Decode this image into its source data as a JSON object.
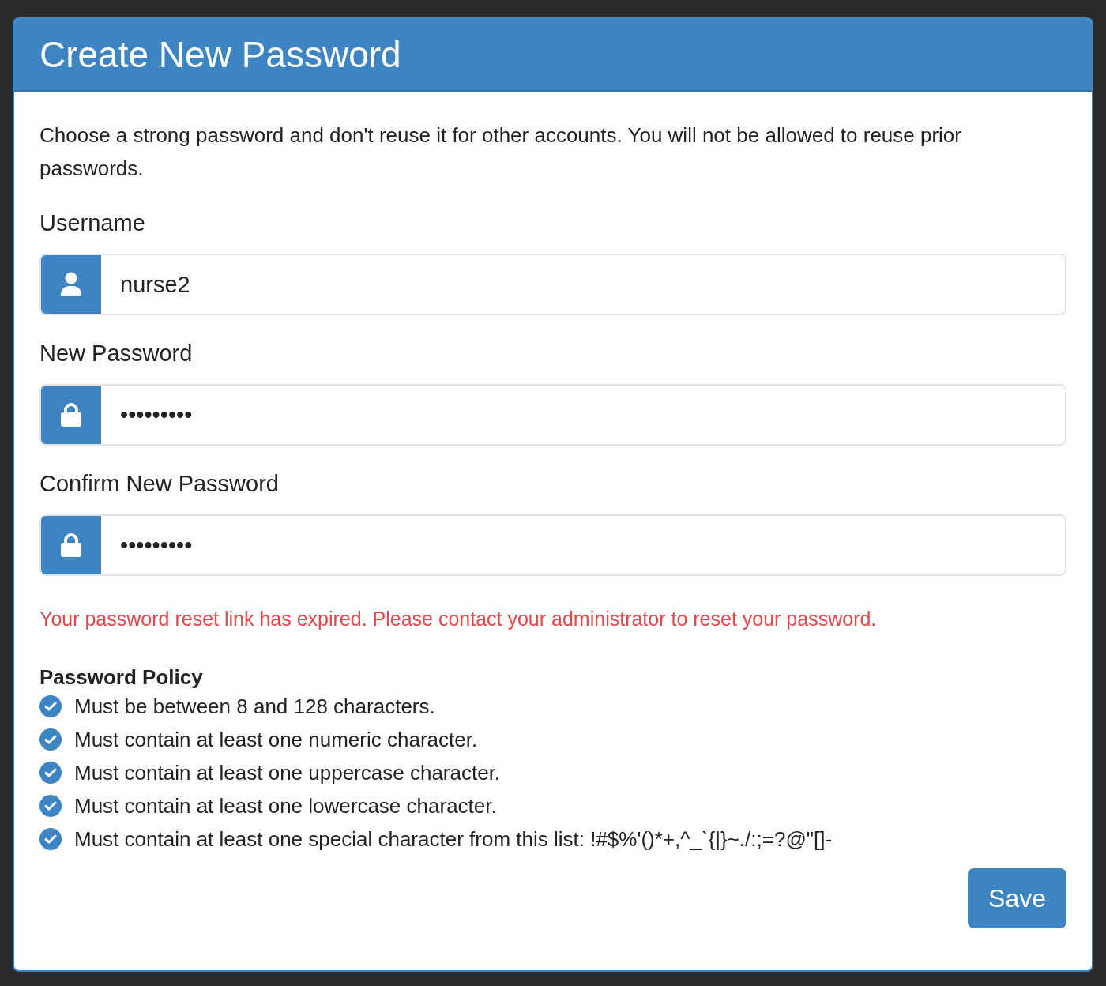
{
  "panel": {
    "title": "Create New Password"
  },
  "intro": "Choose a strong password and don't reuse it for other accounts. You will not be allowed to reuse prior passwords.",
  "fields": [
    {
      "label": "Username",
      "kind": "text",
      "value": "nurse2"
    },
    {
      "label": "New Password",
      "kind": "password",
      "value": "•••••••••"
    },
    {
      "label": "Confirm New Password",
      "kind": "password",
      "value": "•••••••••"
    }
  ],
  "error": "Your password reset link has expired. Please contact your administrator to reset your password.",
  "policy": {
    "title": "Password Policy",
    "rules": [
      {
        "text": "Must be between 8 and 128 characters.",
        "checked": true
      },
      {
        "text": "Must contain at least one numeric character.",
        "checked": true
      },
      {
        "text": "Must contain at least one uppercase character.",
        "checked": true
      },
      {
        "text": "Must contain at least one lowercase character.",
        "checked": true
      },
      {
        "text": "Must contain at least one special character from this list: !#$%'()*+,^_`{|}~./:;=?@\"[]-",
        "checked": true
      }
    ]
  },
  "buttons": [
    {
      "label": "Save"
    }
  ]
}
